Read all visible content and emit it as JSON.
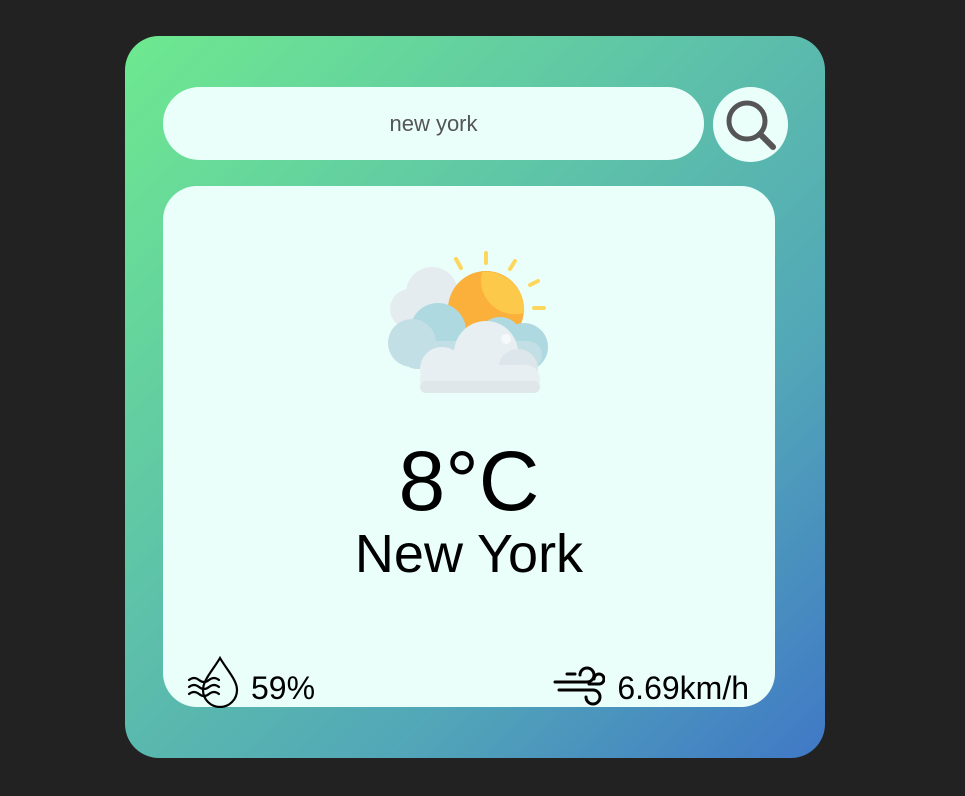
{
  "search": {
    "value": "new york",
    "button_icon": "search-icon"
  },
  "weather": {
    "icon": "partly-cloudy-icon",
    "temperature": "8°C",
    "city": "New York"
  },
  "stats": {
    "humidity": {
      "icon": "humidity-icon",
      "value": "59%"
    },
    "wind": {
      "icon": "wind-icon",
      "value": "6.69km/h"
    }
  },
  "colors": {
    "background": "#222222",
    "gradient_start": "#6ee98f",
    "gradient_end": "#4078c6",
    "card": "#eafff9"
  }
}
